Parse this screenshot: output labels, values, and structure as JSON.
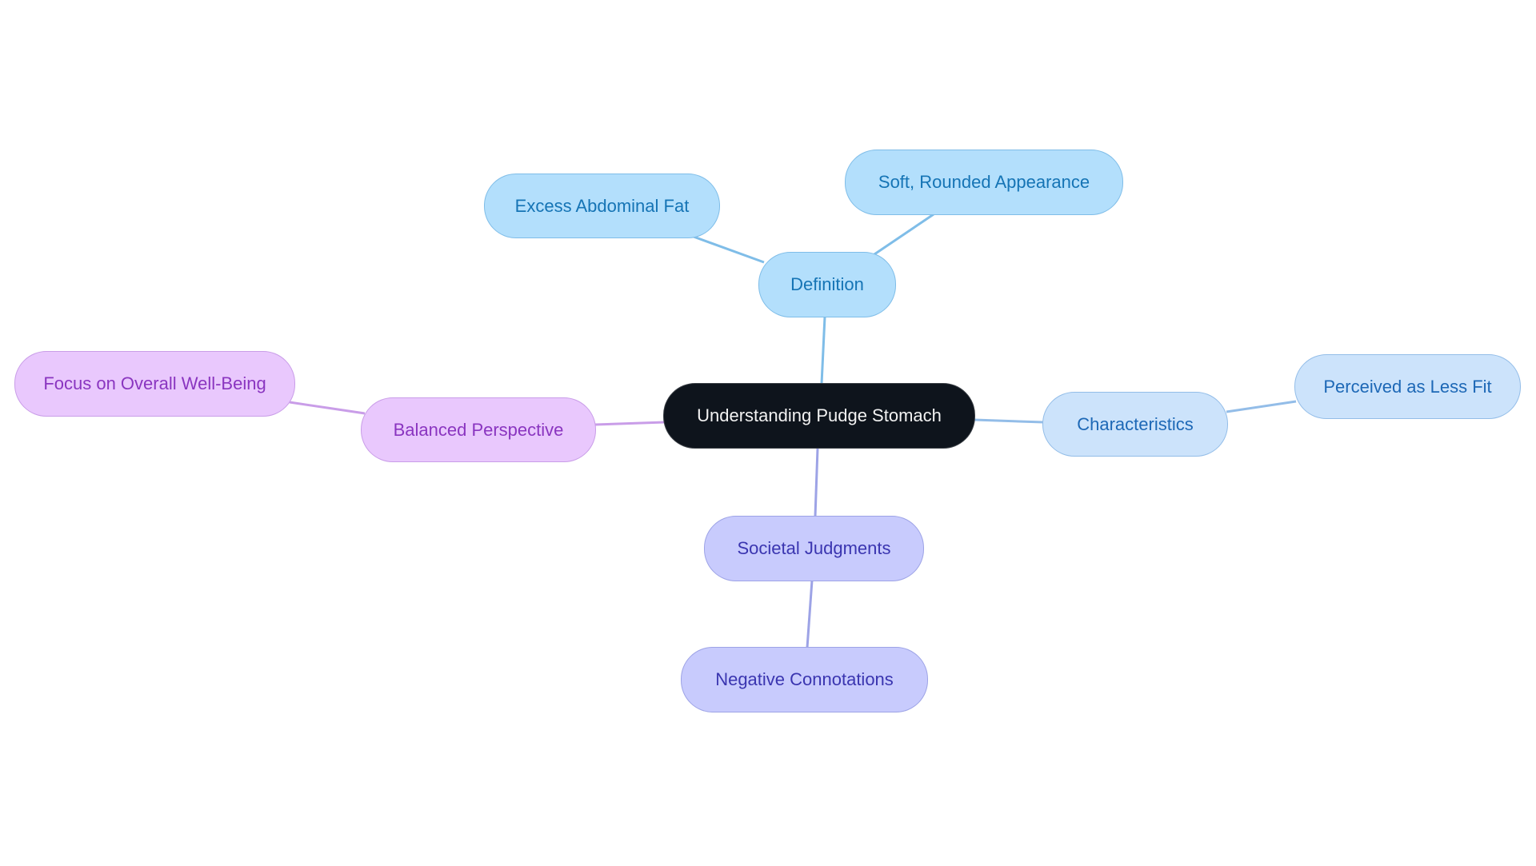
{
  "title": "Understanding Pudge Stomach",
  "root": {
    "id": "root",
    "label": "Understanding Pudge Stomach"
  },
  "branches": [
    {
      "id": "definition",
      "label": "Definition",
      "color": {
        "fill": "#b3dffc",
        "border": "#7fbde8",
        "text": "#1574b5",
        "edge": "#7fbde8"
      },
      "children": [
        {
          "id": "excess-abdominal-fat",
          "label": "Excess Abdominal Fat"
        },
        {
          "id": "soft-rounded-appearance",
          "label": "Soft, Rounded Appearance"
        }
      ]
    },
    {
      "id": "characteristics",
      "label": "Characteristics",
      "color": {
        "fill": "#cce3fb",
        "border": "#93bde8",
        "text": "#1d68b6",
        "edge": "#93bde8"
      },
      "children": [
        {
          "id": "perceived-as-less-fit",
          "label": "Perceived as Less Fit"
        }
      ]
    },
    {
      "id": "societal-judgments",
      "label": "Societal Judgments",
      "color": {
        "fill": "#c8cbfd",
        "border": "#9da3e6",
        "text": "#3a35b0",
        "edge": "#9da3e6"
      },
      "children": [
        {
          "id": "negative-connotations",
          "label": "Negative Connotations"
        }
      ]
    },
    {
      "id": "balanced-perspective",
      "label": "Balanced Perspective",
      "color": {
        "fill": "#e9c8fd",
        "border": "#c99de8",
        "text": "#8a35c0",
        "edge": "#c99de8"
      },
      "children": [
        {
          "id": "focus-on-overall-well-being",
          "label": "Focus on Overall Well-Being"
        }
      ]
    }
  ]
}
